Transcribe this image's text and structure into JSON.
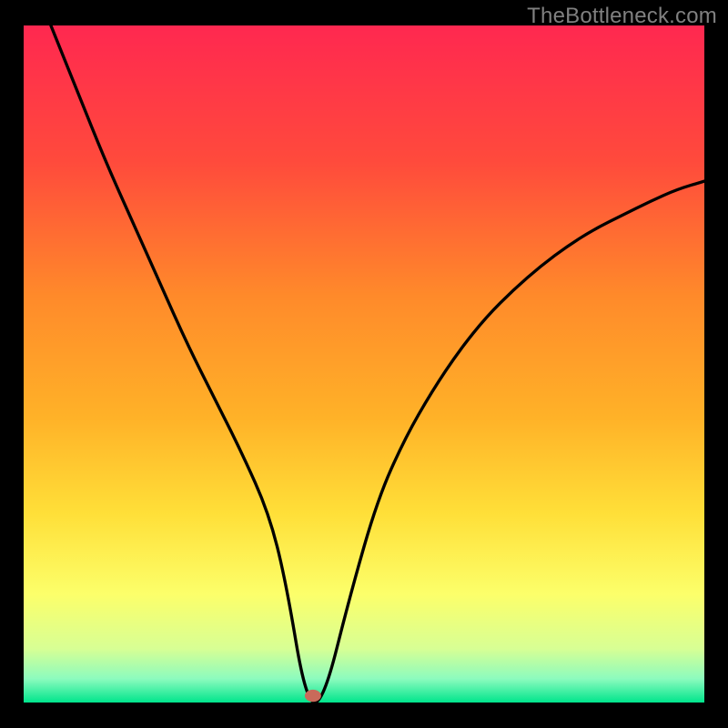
{
  "watermark": "TheBottleneck.com",
  "chart_data": {
    "type": "line",
    "title": "",
    "xlabel": "",
    "ylabel": "",
    "xlim": [
      0,
      100
    ],
    "ylim": [
      0,
      100
    ],
    "grid": false,
    "legend": false,
    "background_gradient": {
      "stops": [
        {
          "offset": 0.0,
          "color": "#ff2850"
        },
        {
          "offset": 0.2,
          "color": "#ff4a3c"
        },
        {
          "offset": 0.4,
          "color": "#ff8a2a"
        },
        {
          "offset": 0.58,
          "color": "#ffb228"
        },
        {
          "offset": 0.72,
          "color": "#ffdf38"
        },
        {
          "offset": 0.84,
          "color": "#fcff6a"
        },
        {
          "offset": 0.92,
          "color": "#d8ff94"
        },
        {
          "offset": 0.965,
          "color": "#8cfbbe"
        },
        {
          "offset": 1.0,
          "color": "#00e58c"
        }
      ]
    },
    "series": [
      {
        "name": "bottleneck-curve",
        "type": "line",
        "color": "#000000",
        "x": [
          4,
          8,
          12,
          16,
          20,
          24,
          28,
          32,
          36,
          38.5,
          41.5,
          44,
          48,
          52,
          56,
          60,
          64,
          68,
          72,
          76,
          80,
          84,
          88,
          92,
          96,
          100
        ],
        "y": [
          100,
          90,
          80,
          71,
          62,
          53,
          45,
          37,
          28,
          18,
          0,
          0,
          16,
          30,
          39,
          46,
          52,
          57,
          61,
          64.5,
          67.5,
          70,
          72,
          74,
          75.8,
          77
        ]
      }
    ],
    "marker": {
      "name": "optimal-point",
      "x": 42.5,
      "y": 0,
      "color": "#c96a5a",
      "rx": 1.2,
      "ry": 0.9
    }
  }
}
